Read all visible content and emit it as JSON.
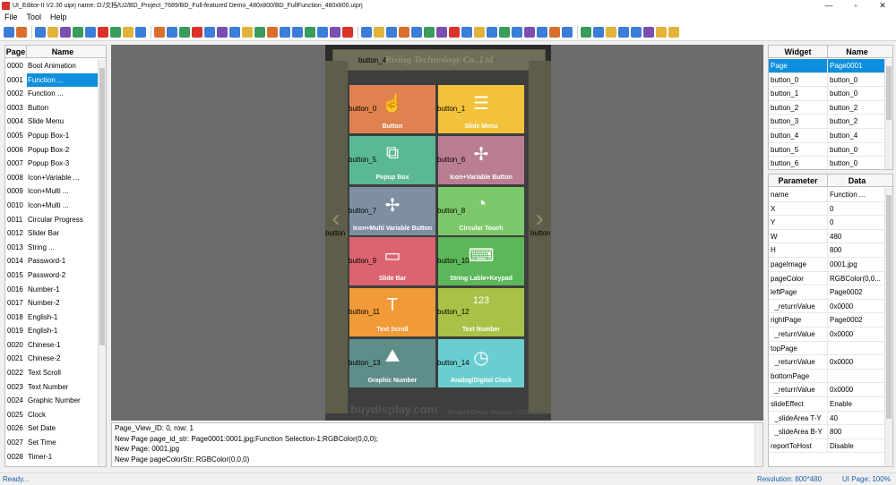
{
  "window": {
    "title": "UI_Editor-II V2.30   uiprj name: D:/文档/U2/BD_Project_7689/BD_Full-featured Demo_480x800/BD_FullFunction_480x800.uiprj",
    "min": "—",
    "max": "▫",
    "close": "✕"
  },
  "menu": [
    "File",
    "Tool",
    "Help"
  ],
  "toolbar_colors": [
    "#3b7dd8",
    "#d86f2c",
    "#3b7dd8",
    "#e2b33a",
    "#7a4fb0",
    "#3a9b5a",
    "#3b7dd8",
    "#d9322a",
    "#3a9b5a",
    "#e2b33a",
    "#3b7dd8",
    "#d86f2c",
    "#3b7dd8",
    "#3a9b5a",
    "#d9322a",
    "#3b7dd8",
    "#7a4fb0",
    "#3b7dd8",
    "#e2b33a",
    "#3a9b5a",
    "#d86f2c",
    "#3b7dd8",
    "#3b7dd8",
    "#3a9b5a",
    "#3b7dd8",
    "#7a4fb0",
    "#d9322a",
    "#3b7dd8",
    "#e2b33a",
    "#3b7dd8",
    "#d86f2c",
    "#3b7dd8",
    "#3a9b5a",
    "#7a4fb0",
    "#d9322a",
    "#3b7dd8",
    "#e2b33a",
    "#3b7dd8",
    "#3a9b5a",
    "#3b7dd8",
    "#7a4fb0",
    "#3b7dd8",
    "#d86f2c",
    "#3b7dd8",
    "#3a9b5a",
    "#3b7dd8",
    "#e2b33a",
    "#3b7dd8",
    "#3b7dd8",
    "#7a4fb0",
    "#e2b33a",
    "#e2b33a"
  ],
  "pages": {
    "header_page": "Page",
    "header_name": "Name",
    "rows": [
      {
        "id": "0000",
        "name": "Boot Animation"
      },
      {
        "id": "0001",
        "name": "Function ..."
      },
      {
        "id": "0002",
        "name": "Function ..."
      },
      {
        "id": "0003",
        "name": "Button"
      },
      {
        "id": "0004",
        "name": "Slide Menu"
      },
      {
        "id": "0005",
        "name": "Popup  Box-1"
      },
      {
        "id": "0006",
        "name": "Popup  Box-2"
      },
      {
        "id": "0007",
        "name": "Popup  Box-3"
      },
      {
        "id": "0008",
        "name": "Icon+Variable ..."
      },
      {
        "id": "0009",
        "name": "Icon+Multi ..."
      },
      {
        "id": "0010",
        "name": "Icon+Multi ..."
      },
      {
        "id": "0011",
        "name": "Circular Progress"
      },
      {
        "id": "0012",
        "name": "Slider Bar"
      },
      {
        "id": "0013",
        "name": "String ..."
      },
      {
        "id": "0014",
        "name": "Password-1"
      },
      {
        "id": "0015",
        "name": "Password-2"
      },
      {
        "id": "0016",
        "name": "Number-1"
      },
      {
        "id": "0017",
        "name": "Number-2"
      },
      {
        "id": "0018",
        "name": "English-1"
      },
      {
        "id": "0019",
        "name": "English-1"
      },
      {
        "id": "0020",
        "name": "Chinese-1"
      },
      {
        "id": "0021",
        "name": "Chinese-2"
      },
      {
        "id": "0022",
        "name": "Text Scroll"
      },
      {
        "id": "0023",
        "name": "Text Number"
      },
      {
        "id": "0024",
        "name": "Graphic Number"
      },
      {
        "id": "0025",
        "name": " Clock"
      },
      {
        "id": "0026",
        "name": "Set Date"
      },
      {
        "id": "0027",
        "name": "Set Time"
      },
      {
        "id": "0028",
        "name": "Timer-1"
      }
    ]
  },
  "canvas": {
    "brand": "Rising Technology Co.,Ltd",
    "button_4": "button_4",
    "left_btn": "button",
    "right_btn": "button",
    "left_arrow": "‹",
    "right_arrow": "›",
    "footer_site": "buydisplay.com",
    "footer_version": "Project Demo Version V20240501",
    "tiles": [
      {
        "wid": "button_0",
        "label": "Button",
        "color": "#e0824f",
        "icon": "☝"
      },
      {
        "wid": "button_1",
        "label": "Slide Menu",
        "color": "#f2c33a",
        "icon": "☰"
      },
      {
        "wid": "button_5",
        "label": "Popup Box",
        "color": "#5ab893",
        "icon": "⧉"
      },
      {
        "wid": "button_6",
        "label": "Icon+Variable Button",
        "color": "#b97e94",
        "icon": "✢"
      },
      {
        "wid": "button_7",
        "label": "Icon+Multi Variable Button",
        "color": "#7e8fa2",
        "icon": "✢"
      },
      {
        "wid": "button_8",
        "label": "Circular Touch",
        "color": "#7cc86a",
        "icon": "◔"
      },
      {
        "wid": "button_9",
        "label": "Slide Bar",
        "color": "#dc6470",
        "icon": "▭"
      },
      {
        "wid": "button_10",
        "label": "String Lable+Keypad",
        "color": "#5cb75a",
        "icon": "⌨"
      },
      {
        "wid": "button_11",
        "label": "Text Scroll",
        "color": "#f09a38",
        "icon": "T"
      },
      {
        "wid": "button_12",
        "label": "Text Number",
        "color": "#a8c247",
        "icon": "123"
      },
      {
        "wid": "button_13",
        "label": "Graphic Number",
        "color": "#5f8d8a",
        "icon": "⛰"
      },
      {
        "wid": "button_14",
        "label": "Analog/Digital Clock",
        "color": "#6bcdcf",
        "icon": "◷"
      }
    ]
  },
  "log": [
    "Page_View_ID: 0, row: 1",
    "New Page page_id_str: Page0001:0001.jpg;Function Selection-1;RGBColor(0,0,0);",
    "New Page: 0001.jpg",
    "New Page pageColorStr: RGBColor(0,0,0)"
  ],
  "widgets": {
    "header_widget": "Widget",
    "header_name": "Name",
    "rows": [
      {
        "w": "Page",
        "n": "Page0001"
      },
      {
        "w": "button_0",
        "n": "button_0"
      },
      {
        "w": "button_1",
        "n": "button_0"
      },
      {
        "w": "button_2",
        "n": "button_2"
      },
      {
        "w": "button_3",
        "n": "button_2"
      },
      {
        "w": "button_4",
        "n": "button_4"
      },
      {
        "w": "button_5",
        "n": "button_0"
      },
      {
        "w": "button_6",
        "n": "button_0"
      }
    ]
  },
  "params": {
    "header_param": "Parameter",
    "header_data": "Data",
    "rows": [
      {
        "k": "name",
        "v": "Function ..."
      },
      {
        "k": "X",
        "v": "0"
      },
      {
        "k": "Y",
        "v": "0"
      },
      {
        "k": "W",
        "v": "480"
      },
      {
        "k": "H",
        "v": "800"
      },
      {
        "k": "pageImage",
        "v": "0001.jpg"
      },
      {
        "k": "pageColor",
        "v": "RGBColor(0,0..."
      },
      {
        "k": "leftPage",
        "v": "Page0002"
      },
      {
        "k": "  _returnValue",
        "v": "0x0000"
      },
      {
        "k": "rightPage",
        "v": "Page0002"
      },
      {
        "k": "  _returnValue",
        "v": "0x0000"
      },
      {
        "k": "topPage",
        "v": ""
      },
      {
        "k": "  _returnValue",
        "v": "0x0000"
      },
      {
        "k": "bottomPage",
        "v": ""
      },
      {
        "k": "  _returnValue",
        "v": "0x0000"
      },
      {
        "k": "slideEffect",
        "v": "Enable"
      },
      {
        "k": "  _slideArea T-Y",
        "v": "40"
      },
      {
        "k": "  _slideArea B-Y",
        "v": "800"
      },
      {
        "k": "reportToHost",
        "v": "Disable"
      }
    ]
  },
  "status": {
    "ready": "Ready...",
    "resolution": "Resolution: 800*480",
    "zoom": "UI Page: 100%"
  }
}
